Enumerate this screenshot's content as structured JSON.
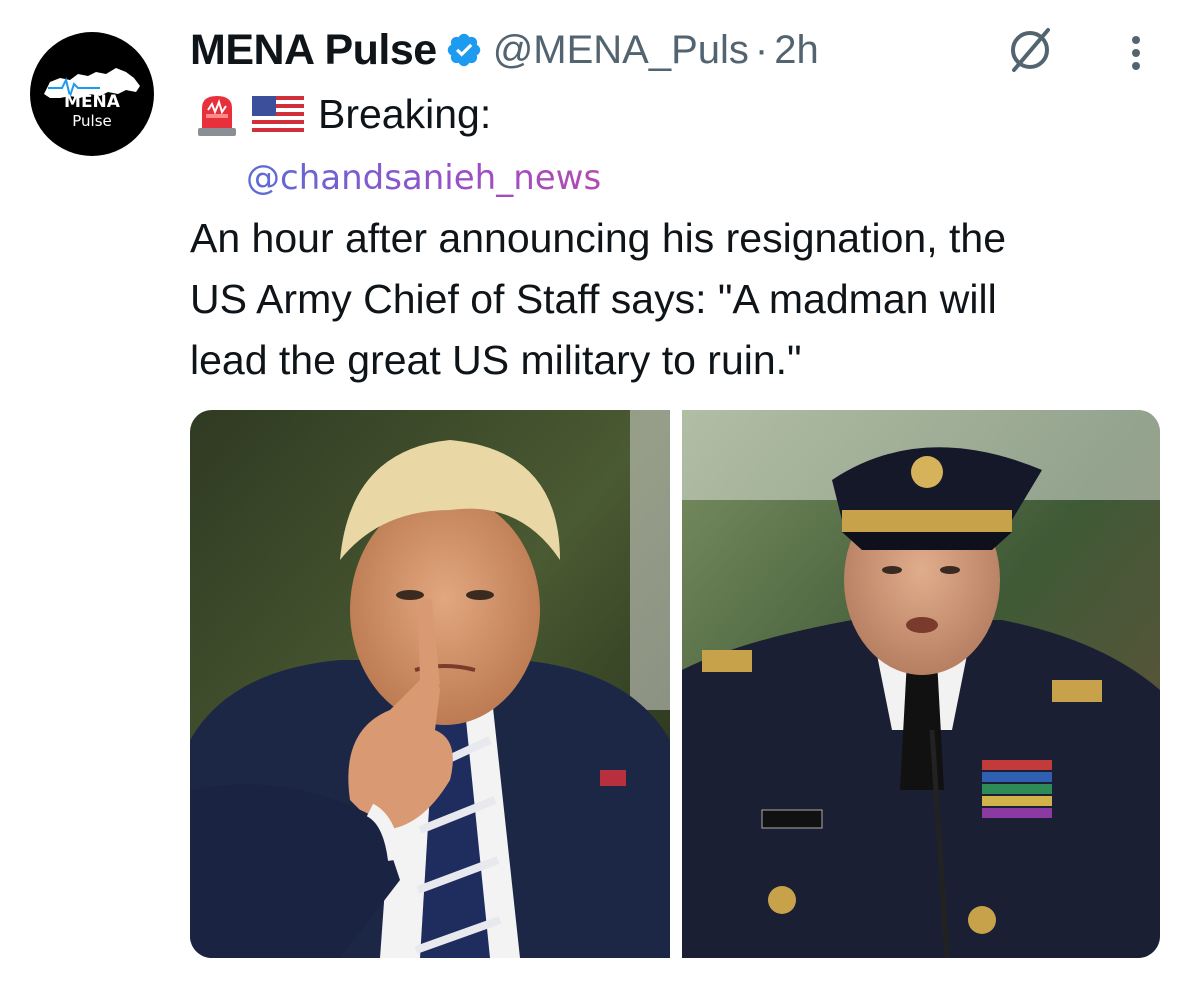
{
  "tweet": {
    "author": {
      "display_name": "MENA Pulse",
      "handle": "@MENA_Puls",
      "avatar_line1": "MENA",
      "avatar_line2": "Pulse",
      "verified": true
    },
    "time": "2h",
    "separator": "·",
    "breaking_label": "Breaking:",
    "emojis": [
      "police-siren-emoji",
      "us-flag-emoji"
    ],
    "mention": "@chandsanieh_news",
    "body_lines": [
      "An hour after announcing his resignation, the",
      "US Army Chief of Staff says: \"A madman will",
      "lead the great US military to ruin.\""
    ],
    "media": [
      {
        "name": "photo-man-pointing",
        "description_icon": "photo"
      },
      {
        "name": "photo-army-officer-speaking",
        "description_icon": "photo"
      }
    ]
  },
  "colors": {
    "text_primary": "#0f1419",
    "text_secondary": "#536471",
    "verified_blue": "#1d9bf0",
    "mention_gradient_start": "#5a6dd6",
    "mention_gradient_end": "#b24bb0"
  },
  "icons": {
    "grok": "grok-icon",
    "more": "more-options-icon",
    "verified": "verified-badge-icon"
  }
}
